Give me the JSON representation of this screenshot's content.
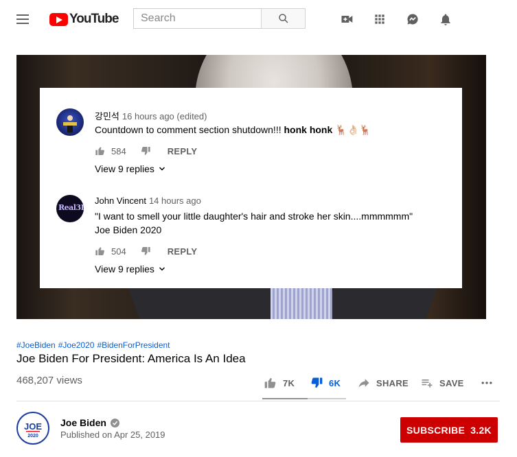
{
  "header": {
    "logo_text": "YouTube",
    "search_placeholder": "Search",
    "icons": [
      "menu-icon",
      "search-icon",
      "create-video-icon",
      "apps-icon",
      "messages-icon",
      "notifications-icon"
    ]
  },
  "comments": [
    {
      "author": "강민석",
      "time": "16 hours ago (edited)",
      "text": "Countdown to comment section shutdown!!! ",
      "text_bold": "honk honk",
      "emoji": "🦌👌🏻🦌",
      "likes": "584",
      "reply_label": "REPLY",
      "view_replies": "View 9 replies"
    },
    {
      "author": "John Vincent",
      "time": "14 hours ago",
      "text_line1": "\"I want to smell your little daughter's hair and stroke her skin....mmmmmm\"",
      "text_line2": "Joe Biden 2020",
      "avatar_text": "Real3R",
      "likes": "504",
      "reply_label": "REPLY",
      "view_replies": "View 9 replies"
    }
  ],
  "video": {
    "hashtags": [
      "#JoeBiden",
      "#Joe2020",
      "#BidenForPresident"
    ],
    "title": "Joe Biden For President: America Is An Idea",
    "views": "468,207 views",
    "likes": "7K",
    "dislikes": "6K",
    "like_ratio": 0.54,
    "share_label": "SHARE",
    "save_label": "SAVE"
  },
  "channel": {
    "name": "Joe Biden",
    "published": "Published on Apr 25, 2019",
    "avatar_text_top": "JOE",
    "avatar_text_bottom": "2020",
    "subscribe_label": "SUBSCRIBE",
    "subscriber_count": "3.2K"
  },
  "colors": {
    "brand_red": "#ff0000",
    "subscribe_red": "#cc0000",
    "link_blue": "#065fd4",
    "dislike_active": "#065fd4"
  }
}
